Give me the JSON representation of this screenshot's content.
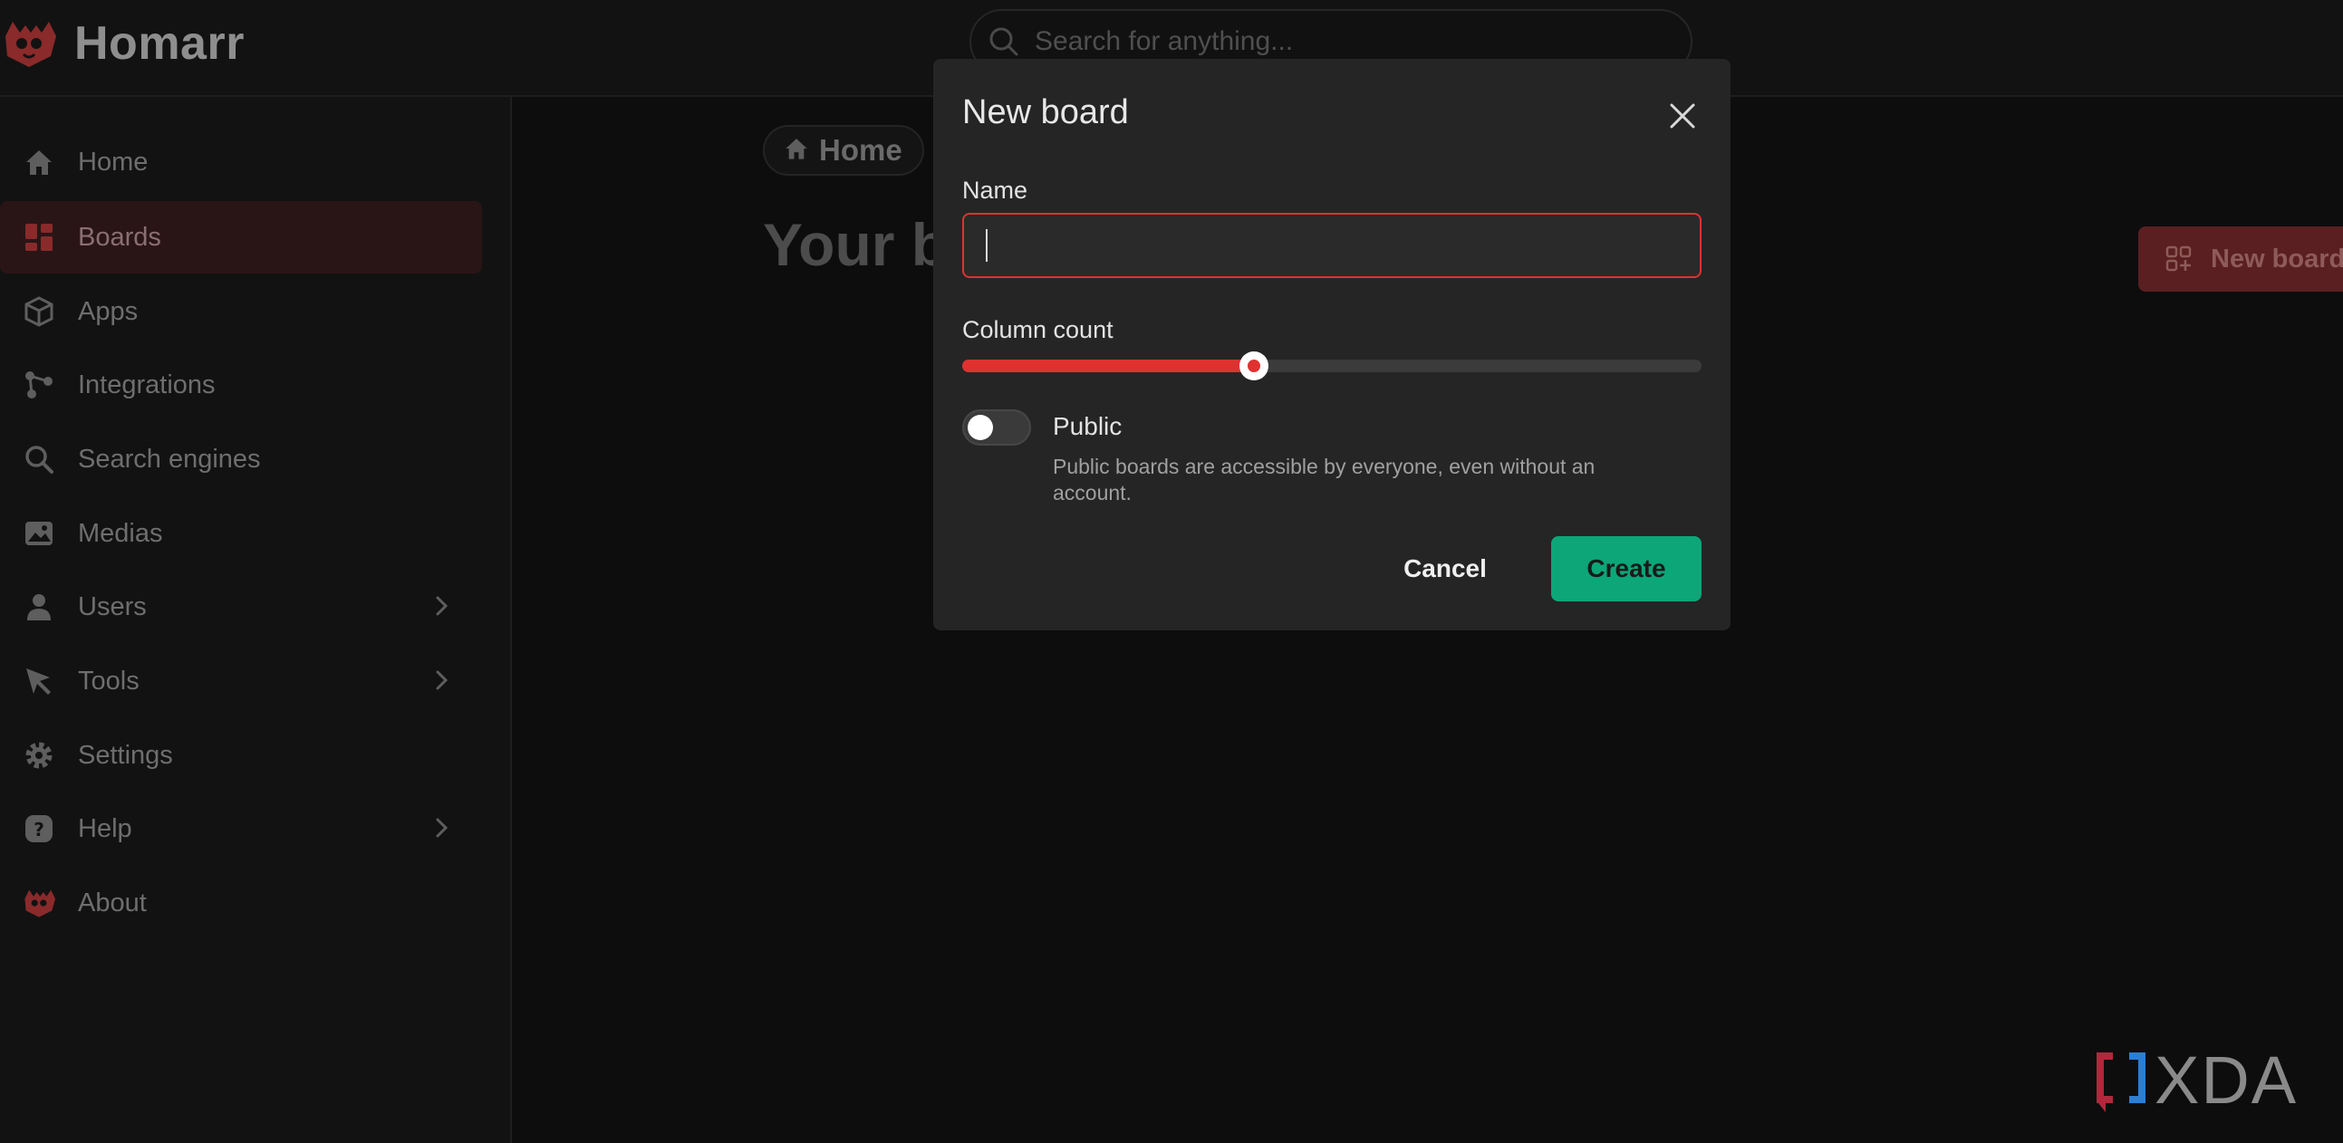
{
  "app": {
    "title": "Homarr"
  },
  "search": {
    "placeholder": "Search for anything..."
  },
  "sidebar": {
    "items": [
      {
        "label": "Home",
        "icon": "home-icon"
      },
      {
        "label": "Boards",
        "icon": "boards-icon",
        "active": true
      },
      {
        "label": "Apps",
        "icon": "box-icon"
      },
      {
        "label": "Integrations",
        "icon": "integrations-icon"
      },
      {
        "label": "Search engines",
        "icon": "search-icon"
      },
      {
        "label": "Medias",
        "icon": "photo-icon"
      },
      {
        "label": "Users",
        "icon": "user-icon",
        "expandable": true
      },
      {
        "label": "Tools",
        "icon": "pointer-icon",
        "expandable": true
      },
      {
        "label": "Settings",
        "icon": "gear-icon"
      },
      {
        "label": "Help",
        "icon": "help-icon",
        "expandable": true
      },
      {
        "label": "About",
        "icon": "homarr-logo-icon"
      }
    ]
  },
  "main": {
    "breadcrumb": {
      "label": "Home"
    },
    "page_title": "Your boards",
    "new_board_button": "New board"
  },
  "modal": {
    "title": "New board",
    "name_label": "Name",
    "name_value": "",
    "column_count_label": "Column count",
    "column_count_fraction": 0.395,
    "public_label": "Public",
    "public_enabled": false,
    "public_description": "Public boards are accessible by everyone, even without an account.",
    "cancel_label": "Cancel",
    "create_label": "Create"
  },
  "watermark": {
    "text": "XDA"
  },
  "colors": {
    "accent": "#e03131",
    "create": "#0ca678",
    "modal_bg": "#252525",
    "page_bg": "#0d0d0d"
  }
}
